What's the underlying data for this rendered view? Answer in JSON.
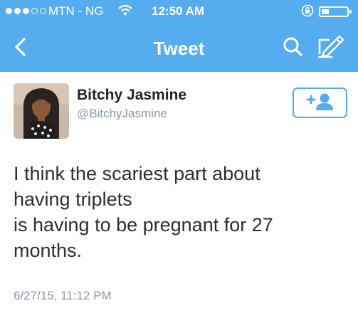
{
  "status_bar": {
    "carrier": "MTN - NG",
    "time": "12:50 AM",
    "signal_bars": 3,
    "signal_max": 5,
    "battery_level": 0.3
  },
  "nav": {
    "title": "Tweet",
    "icons": [
      "back-chevron-icon",
      "search-icon",
      "compose-icon"
    ]
  },
  "tweet": {
    "display_name": "Bitchy Jasmine",
    "handle": "@BitchyJasmine",
    "text": "I think the scariest part about\nhaving triplets\nis having to be pregnant for 27\nmonths.",
    "timestamp": "6/27/15, 11:12 PM",
    "follow_icon": "add-user-icon"
  },
  "colors": {
    "accent": "#55acee",
    "text": "#292f33",
    "muted": "#8899a6"
  }
}
